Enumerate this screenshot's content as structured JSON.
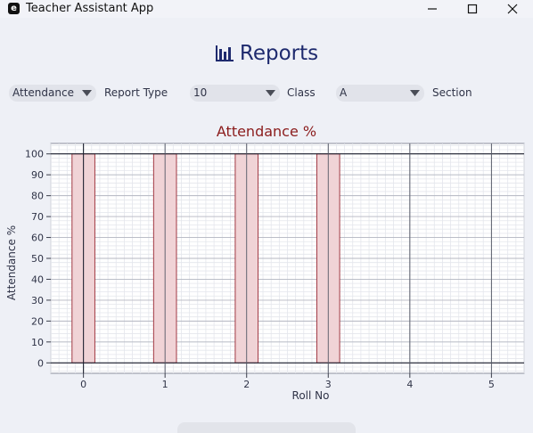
{
  "window": {
    "title": "Teacher Assistant App",
    "app_icon_letter": "e"
  },
  "header": {
    "title": "Reports",
    "icon": "bar-chart-icon"
  },
  "filters": {
    "report_type_value": "Attendance",
    "report_type_label": "Report Type",
    "class_value": "10",
    "class_label": "Class",
    "section_value": "A",
    "section_label": "Section"
  },
  "colors": {
    "title_blue": "#1e2a6e",
    "chart_title": "#8b1c1c",
    "bar_fill": "#f0d3d6",
    "bar_edge": "#a23a44"
  },
  "chart_data": {
    "type": "bar",
    "title": "Attendance %",
    "xlabel": "Roll No",
    "ylabel": "Attendance %",
    "categories": [
      0,
      1,
      2,
      3
    ],
    "values": [
      100,
      100,
      100,
      100
    ],
    "xlim": [
      -0.4,
      5.4
    ],
    "ylim": [
      -5,
      105
    ],
    "xticks": [
      "0",
      "1",
      "2",
      "3",
      "4",
      "5"
    ],
    "yticks": [
      "0",
      "10",
      "20",
      "30",
      "40",
      "50",
      "60",
      "70",
      "80",
      "90",
      "100"
    ],
    "bar_width": 0.28,
    "grid": true
  }
}
